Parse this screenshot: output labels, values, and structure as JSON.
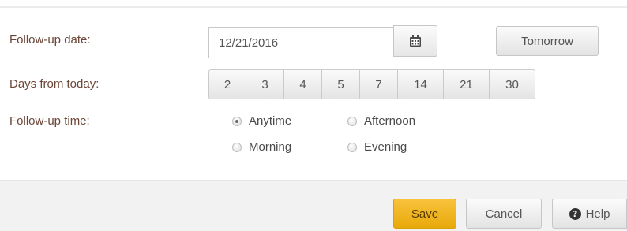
{
  "form": {
    "followup_date_label": "Follow-up date:",
    "days_from_today_label": "Days from today:",
    "followup_time_label": "Follow-up time:",
    "date_value": "12/21/2016",
    "calendar_icon": "calendar-icon",
    "tomorrow_label": "Tomorrow",
    "days": [
      "2",
      "3",
      "4",
      "5",
      "7",
      "14",
      "21",
      "30"
    ],
    "time_options": {
      "anytime": "Anytime",
      "afternoon": "Afternoon",
      "morning": "Morning",
      "evening": "Evening"
    },
    "selected_time": "Anytime"
  },
  "footer": {
    "save_label": "Save",
    "cancel_label": "Cancel",
    "help_label": "Help",
    "help_icon": "question-circle-icon"
  },
  "colors": {
    "label_text": "#6b4536",
    "save_button": "#f0b31e"
  }
}
